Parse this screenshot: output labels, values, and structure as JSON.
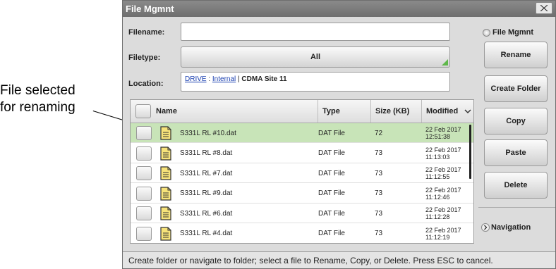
{
  "callout": {
    "line1": "File selected",
    "line2": "for renaming"
  },
  "window": {
    "title": "File Mgmnt"
  },
  "form": {
    "filename_label": "Filename:",
    "filename_value": "",
    "filetype_label": "Filetype:",
    "filetype_value": "All",
    "location_label": "Location:",
    "location_drive": "DRIVE",
    "location_sep1": " : ",
    "location_internal": "Internal",
    "location_sep2": " | ",
    "location_folder": "CDMA Site 11"
  },
  "table": {
    "headers": {
      "name": "Name",
      "type": "Type",
      "size": "Size (KB)",
      "modified": "Modified"
    },
    "rows": [
      {
        "name": "S331L RL #10.dat",
        "type": "DAT File",
        "size": "72",
        "date": "22 Feb 2017",
        "time": "12:51:38",
        "selected": true
      },
      {
        "name": "S331L RL #8.dat",
        "type": "DAT File",
        "size": "73",
        "date": "22 Feb 2017",
        "time": "11:13:03",
        "selected": false
      },
      {
        "name": "S331L RL #7.dat",
        "type": "DAT File",
        "size": "73",
        "date": "22 Feb 2017",
        "time": "11:12:55",
        "selected": false
      },
      {
        "name": "S331L RL #9.dat",
        "type": "DAT File",
        "size": "73",
        "date": "22 Feb 2017",
        "time": "11:12:46",
        "selected": false
      },
      {
        "name": "S331L RL #6.dat",
        "type": "DAT File",
        "size": "73",
        "date": "22 Feb 2017",
        "time": "11:12:28",
        "selected": false
      },
      {
        "name": "S331L RL #4.dat",
        "type": "DAT File",
        "size": "73",
        "date": "22 Feb 2017",
        "time": "11:12:19",
        "selected": false
      }
    ]
  },
  "sidebar": {
    "header": "File Mgmnt",
    "buttons": {
      "rename": "Rename",
      "create_folder": "Create Folder",
      "copy": "Copy",
      "paste": "Paste",
      "delete": "Delete"
    },
    "navigation": "Navigation"
  },
  "status": "Create folder or navigate to folder; select a file to Rename, Copy, or Delete. Press ESC to cancel.",
  "colors": {
    "selected_row": "#c8e4b8",
    "accent_green": "#5fb84a",
    "link_blue": "#1a3fb0"
  }
}
